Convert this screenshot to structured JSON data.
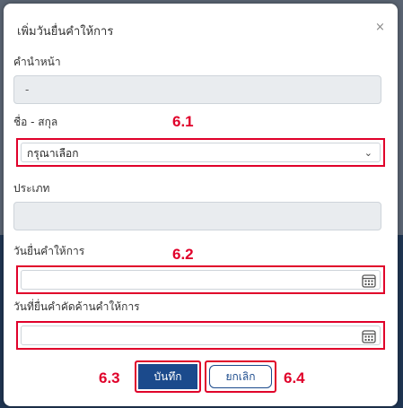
{
  "modal": {
    "title": "เพิ่มวันยื่นคำให้การ",
    "close_symbol": "×"
  },
  "form": {
    "prefix_label": "คำนำหน้า",
    "prefix_value": "-",
    "name_label": "ชื่อ - สกุล",
    "name_select_value": "กรุณาเลือก",
    "type_label": "ประเภท",
    "type_value": "",
    "filing_date_label": "วันยื่นคำให้การ",
    "objection_date_label": "วันที่ยื่นคำคัดค้านคำให้การ"
  },
  "buttons": {
    "save_label": "บันทึก",
    "cancel_label": "ยกเลิก"
  },
  "annotations": {
    "step_name": "6.1",
    "step_filing_date": "6.2",
    "step_save": "6.3",
    "step_cancel": "6.4",
    "color": "#e0002a"
  },
  "icons": {
    "close": "close-icon",
    "select": "chevron-down-icon",
    "date": "calendar-icon"
  }
}
